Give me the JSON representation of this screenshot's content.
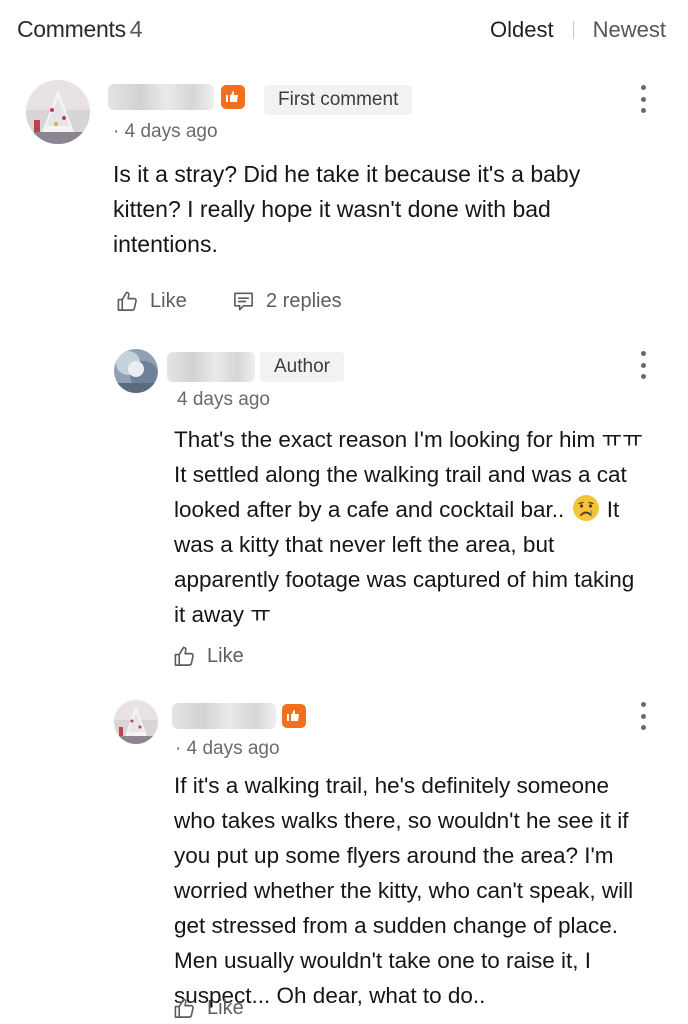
{
  "header": {
    "title": "Comments",
    "count": "4",
    "sort_oldest": "Oldest",
    "sort_newest": "Newest"
  },
  "comments": [
    {
      "badge_label": "First comment",
      "time": "· 4 days ago",
      "text": "Is it a stray? Did he take it because it's a baby kitten? I really hope it wasn't done with bad intentions.",
      "like_label": "Like",
      "replies_label": "2 replies",
      "replies": [
        {
          "badge_label": "Author",
          "time": "4 days ago",
          "text_part1": "That's the exact reason I'm looking for him ㅠㅠ\nIt settled along the walking trail and was a cat\nlooked after by a cafe and cocktail bar..",
          "text_part2": " It\nwas a kitty that never left the area, but\napparently footage was captured of him taking\nit away ㅠ",
          "emoji": "crying-face-emoji",
          "like_label": "Like"
        },
        {
          "time": "· 4 days ago",
          "text": "If it's a walking trail, he's definitely someone\nwho takes walks there, so wouldn't he see it if\nyou put up some flyers around the area? I'm\nworried whether the kitty, who can't speak, will\nget stressed from a sudden change of place.\nMen usually wouldn't take one to raise it, I\nsuspect... Oh dear, what to do..",
          "like_label": "Like"
        }
      ]
    }
  ],
  "colors": {
    "badge_orange": "#f0701e",
    "tag_bg": "#f1f2f4"
  },
  "icons": [
    "thumbs-up-icon",
    "reply-icon",
    "more-vertical-icon",
    "fan-badge-icon"
  ]
}
